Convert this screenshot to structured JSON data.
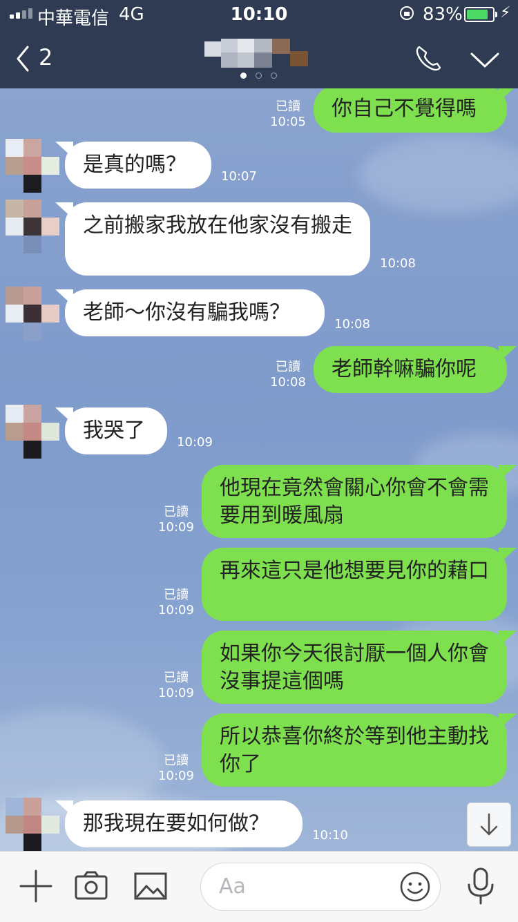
{
  "status_bar": {
    "carrier": "中華電信",
    "network": "4G",
    "time": "10:10",
    "battery_percent": "83%",
    "battery_level": 0.83
  },
  "header": {
    "back_count": "2",
    "page_indicator": {
      "count": 3,
      "active": 0
    }
  },
  "messages": [
    {
      "side": "out",
      "text": "你自己不覺得嗎",
      "read": "已讀",
      "time": "10:05"
    },
    {
      "side": "in",
      "text": "是真的嗎？",
      "time": "10:07"
    },
    {
      "side": "in",
      "text": "之前搬家我放在他家沒有搬走",
      "time": "10:08"
    },
    {
      "side": "in",
      "text": "老師～你沒有騙我嗎？",
      "time": "10:08"
    },
    {
      "side": "out",
      "text": "老師幹嘛騙你呢",
      "read": "已讀",
      "time": "10:08"
    },
    {
      "side": "in",
      "text": "我哭了",
      "time": "10:09"
    },
    {
      "side": "out",
      "text": "他現在竟然會關心你會不會需要用到暖風扇",
      "read": "已讀",
      "time": "10:09"
    },
    {
      "side": "out",
      "text": "再來這只是他想要見你的藉口",
      "read": "已讀",
      "time": "10:09"
    },
    {
      "side": "out",
      "text": "如果你今天很討厭一個人你會沒事提這個嗎",
      "read": "已讀",
      "time": "10:09"
    },
    {
      "side": "out",
      "text": "所以恭喜你終於等到他主動找你了",
      "read": "已讀",
      "time": "10:09"
    },
    {
      "side": "in",
      "text": "那我現在要如何做？",
      "time": "10:10"
    }
  ],
  "input": {
    "placeholder": "Aa"
  },
  "icons": {
    "back": "chevron-left-icon",
    "call": "phone-icon",
    "menu": "chevron-down-icon",
    "add": "plus-icon",
    "camera": "camera-icon",
    "image": "image-icon",
    "emoji": "smiley-icon",
    "mic": "microphone-icon",
    "scroll": "arrow-down-icon"
  },
  "colors": {
    "header_bg": "#2f3b52",
    "outgoing_bubble": "#7ee04f",
    "incoming_bubble": "#ffffff",
    "chat_bg": "#7f9bcb",
    "battery": "#4cd964"
  }
}
